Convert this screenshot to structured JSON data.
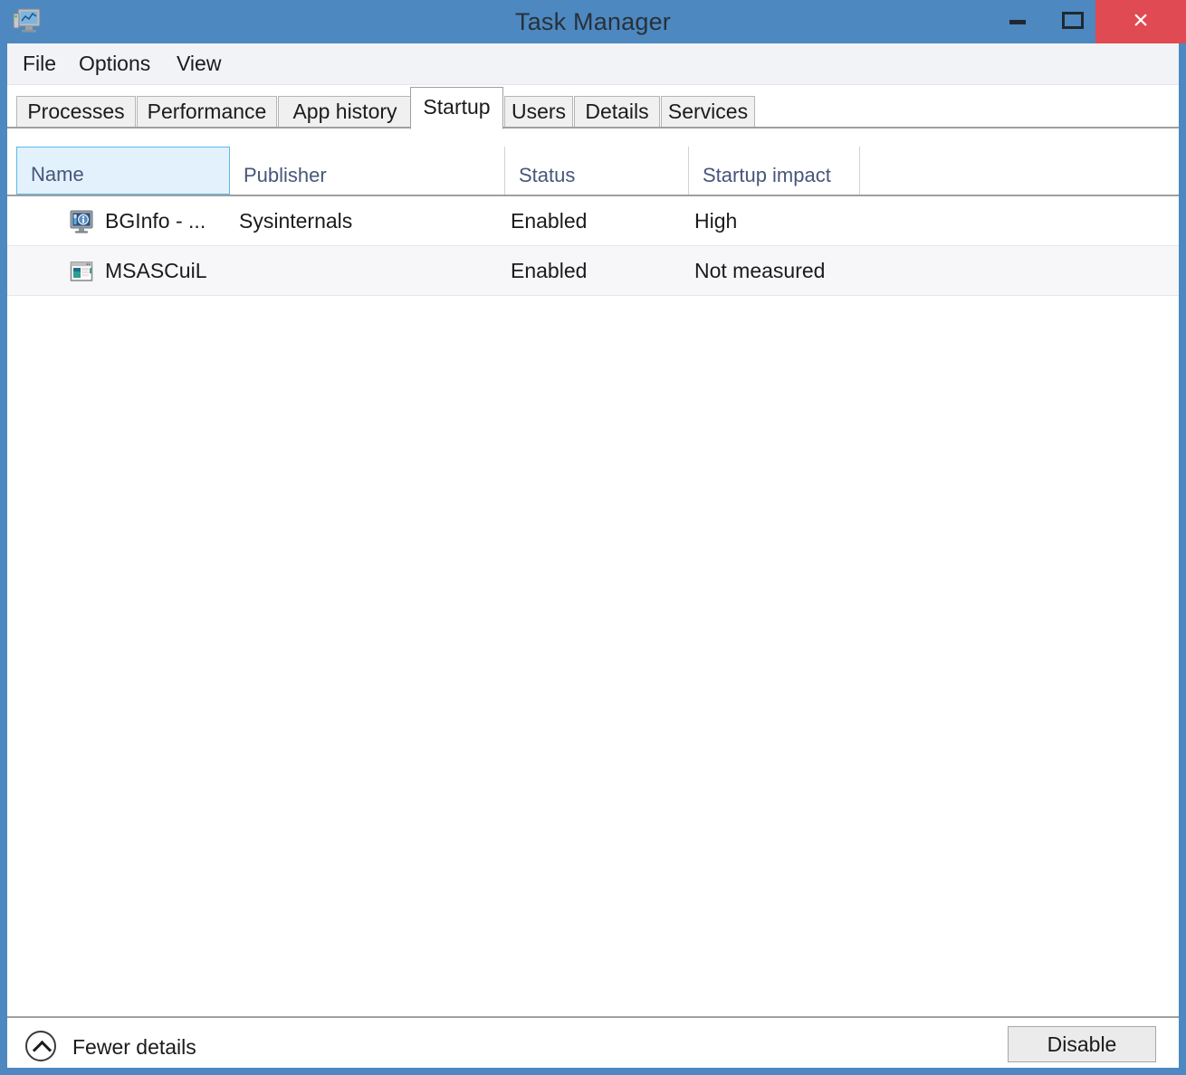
{
  "window": {
    "title": "Task Manager",
    "icon": "task-manager-icon",
    "accent_color": "#4d88c0",
    "close_color": "#e04a52",
    "controls": {
      "minimize": "–",
      "maximize": "□",
      "close": "×"
    }
  },
  "menubar": {
    "items": [
      {
        "label": "File"
      },
      {
        "label": "Options"
      },
      {
        "label": "View"
      }
    ]
  },
  "tabs": [
    {
      "label": "Processes",
      "active": false
    },
    {
      "label": "Performance",
      "active": false
    },
    {
      "label": "App history",
      "active": false
    },
    {
      "label": "Startup",
      "active": true
    },
    {
      "label": "Users",
      "active": false
    },
    {
      "label": "Details",
      "active": false
    },
    {
      "label": "Services",
      "active": false
    }
  ],
  "table": {
    "columns": [
      {
        "label": "Name",
        "sorted": true,
        "sort_direction": "ascending"
      },
      {
        "label": "Publisher",
        "sorted": false
      },
      {
        "label": "Status",
        "sorted": false
      },
      {
        "label": "Startup impact",
        "sorted": false
      }
    ],
    "rows": [
      {
        "icon": "bginfo-monitor-icon",
        "name": "BGInfo - ...",
        "publisher": "Sysinternals",
        "status": "Enabled",
        "impact": "High"
      },
      {
        "icon": "msascuil-window-icon",
        "name": "MSASCuiL",
        "publisher": "",
        "status": "Enabled",
        "impact": "Not measured"
      }
    ]
  },
  "footer": {
    "fewer_details_label": "Fewer details",
    "fewer_details_icon": "chevron-up-circle-icon",
    "disable_label": "Disable"
  }
}
